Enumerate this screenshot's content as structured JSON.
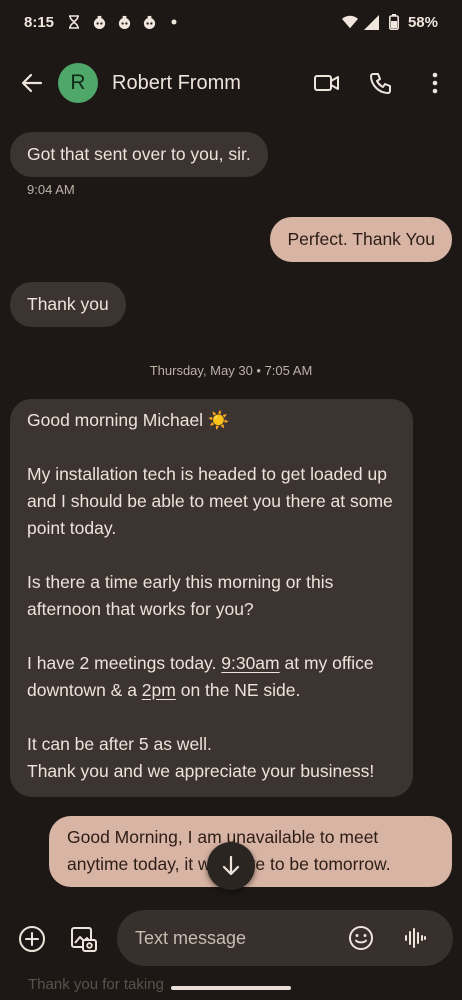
{
  "status": {
    "time": "8:15",
    "battery": "58%",
    "icons": [
      "hourglass-icon",
      "app-icon",
      "app-icon",
      "app-icon",
      "dot-icon",
      "wifi-icon",
      "signal-icon",
      "battery-icon"
    ]
  },
  "header": {
    "avatar_letter": "R",
    "contact_name": "Robert Fromm",
    "avatar_color": "#4fa86a"
  },
  "messages": {
    "m1": {
      "text": "Got that sent over to you, sir.",
      "time": "9:04 AM"
    },
    "m2": {
      "text": "Perfect.  Thank You"
    },
    "m3": {
      "text": "Thank you"
    },
    "date_separator": "Thursday, May 30 • 7:05 AM",
    "m4": {
      "p1": "Good morning Michael ☀️",
      "p2": "My installation tech is headed to get loaded up and I should be able to meet you there at some point today.",
      "p3": "Is there a time early this morning or this afternoon that works for you?",
      "p4_a": "I have 2 meetings today. ",
      "p4_b": "9:30am",
      "p4_c": " at my office downtown & a ",
      "p4_d": "2pm",
      "p4_e": " on the NE side.",
      "p5": "It can be after 5 as well.",
      "p6": "Thank you and we appreciate your business!"
    },
    "m5": {
      "text": "Good Morning, I am unavailable to meet anytime today, it will have to be tomorrow."
    }
  },
  "composer": {
    "placeholder": "Text message",
    "peek": "Thank you for taking"
  },
  "colors": {
    "background": "#1d1815",
    "incoming_bubble": "#3b3430",
    "outgoing_bubble": "#d8b4a4"
  }
}
